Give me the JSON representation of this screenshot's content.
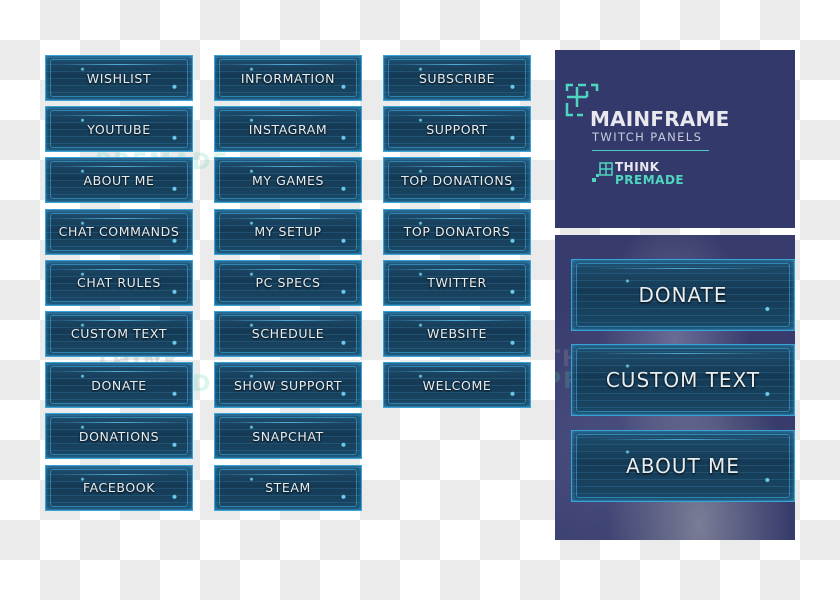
{
  "columns": [
    {
      "panels": [
        "WISHLIST",
        "YOUTUBE",
        "ABOUT ME",
        "CHAT COMMANDS",
        "CHAT RULES",
        "CUSTOM TEXT",
        "DONATE",
        "DONATIONS",
        "FACEBOOK"
      ]
    },
    {
      "panels": [
        "INFORMATION",
        "INSTAGRAM",
        "MY GAMES",
        "MY SETUP",
        "PC SPECS",
        "SCHEDULE",
        "SHOW SUPPORT",
        "SNAPCHAT",
        "STEAM"
      ]
    },
    {
      "panels": [
        "SUBSCRIBE",
        "SUPPORT",
        "TOP DONATIONS",
        "TOP DONATORS",
        "TWITTER",
        "WEBSITE",
        "WELCOME"
      ]
    }
  ],
  "brand": {
    "title": "MAINFRAME",
    "subtitle": "TWITCH PANELS",
    "maker_line1": "THINK",
    "maker_line2": "PREMADE",
    "bg_color": "#333a6b",
    "accent_color": "#4fd6bf"
  },
  "preview": {
    "panels": [
      "DONATE",
      "CUSTOM TEXT",
      "ABOUT ME"
    ]
  },
  "watermark": {
    "line1": "THINK",
    "line2": "PREMADE"
  }
}
